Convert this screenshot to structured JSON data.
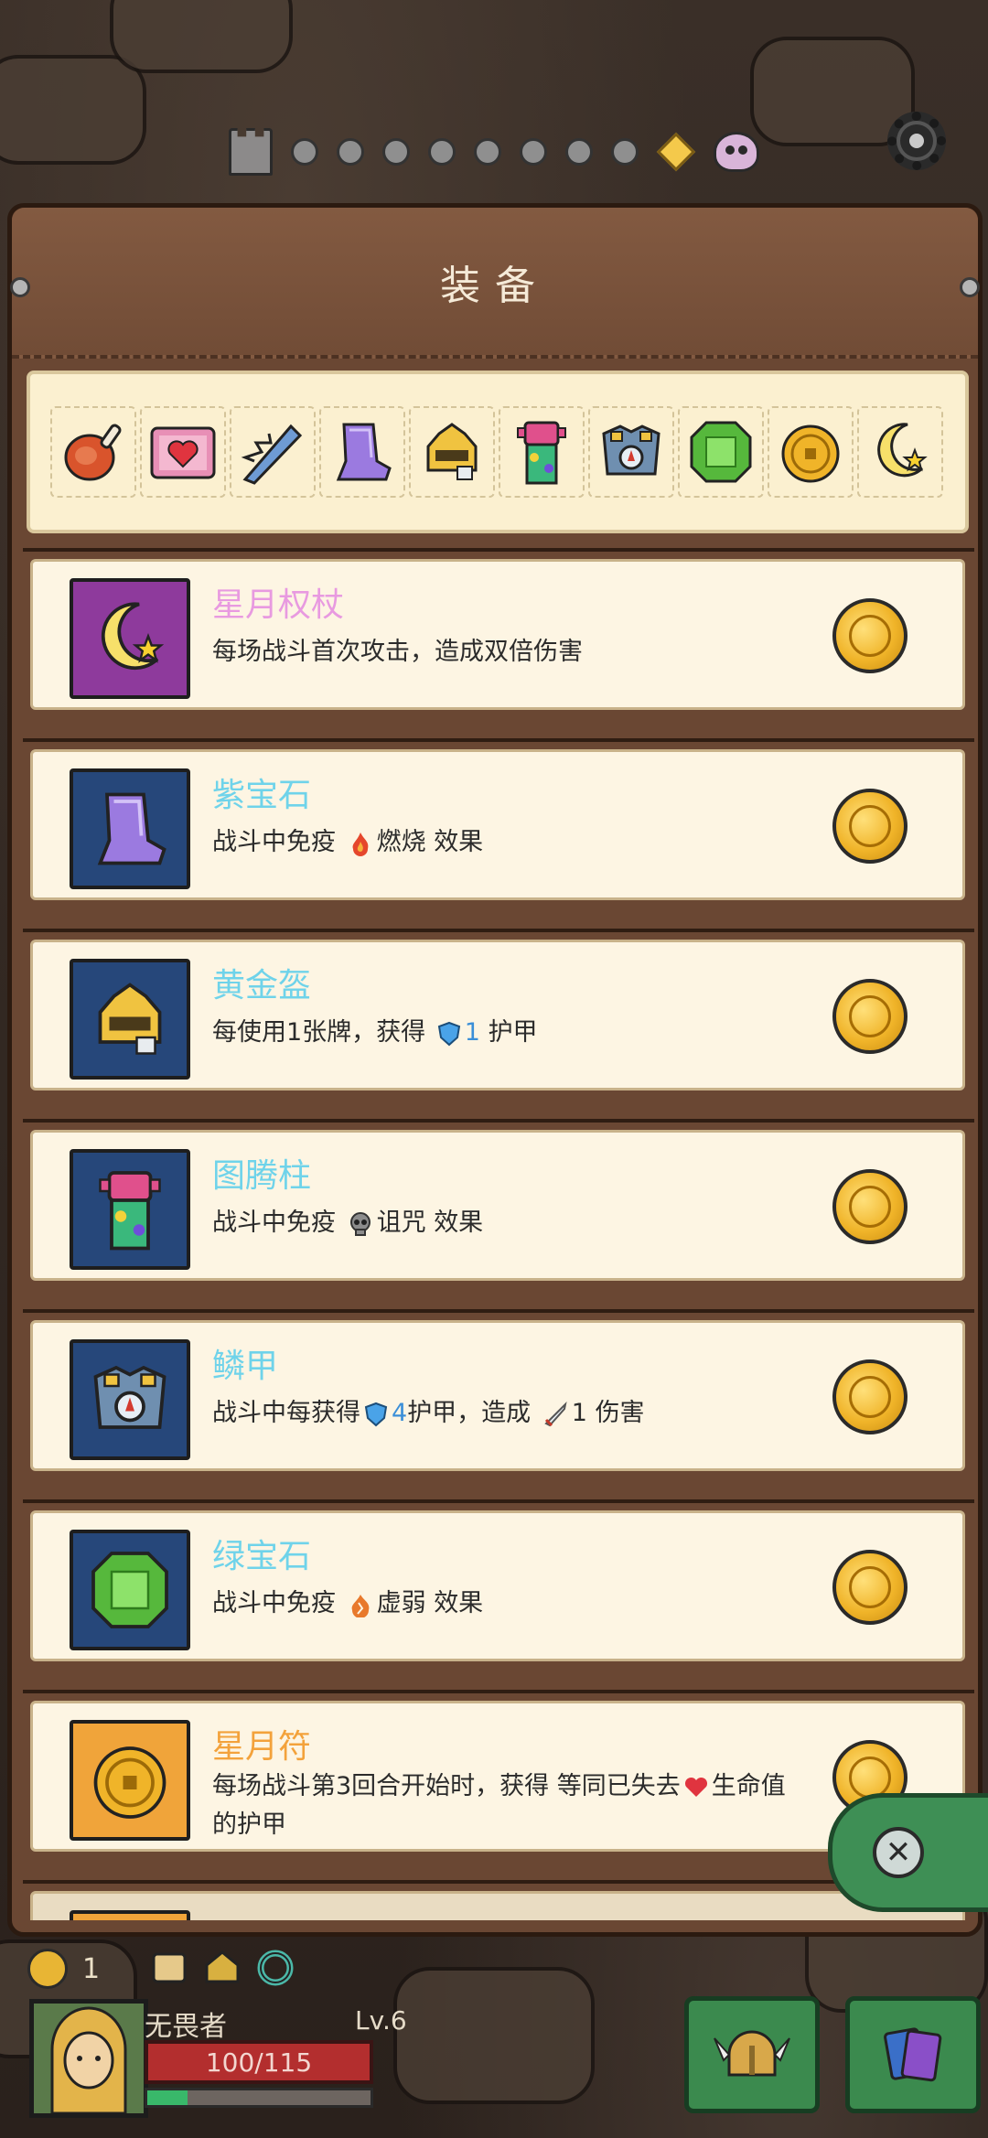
{
  "panel": {
    "title": "装备"
  },
  "equipment_strip": {
    "slots": [
      "meat-icon",
      "heart-box-icon",
      "spiked-club-icon",
      "purple-gem-boot-icon",
      "golden-helmet-icon",
      "totem-icon",
      "scale-armor-icon",
      "green-gem-icon",
      "gold-amulet-icon",
      "star-moon-scepter-icon"
    ]
  },
  "items": [
    {
      "name": "星月权杖",
      "name_color": "#e89ae0",
      "icon": "star-moon-scepter-icon",
      "icon_bg": "#8e3a9c",
      "desc_parts": [
        "每场战斗首次攻击，造成双倍伤害"
      ]
    },
    {
      "name": "紫宝石",
      "name_color": "#6fd3ea",
      "icon": "purple-gem-boot-icon",
      "icon_bg": "#26477a",
      "desc_parts": [
        "战斗中免疫",
        "燃烧",
        "效果"
      ],
      "status_icon": "fire-icon"
    },
    {
      "name": "黄金盔",
      "name_color": "#6fd3ea",
      "icon": "golden-helmet-icon",
      "icon_bg": "#26477a",
      "desc_parts": [
        "每使用1张牌，获得",
        "1",
        "护甲"
      ],
      "status_icon": "shield-icon"
    },
    {
      "name": "图腾柱",
      "name_color": "#6fd3ea",
      "icon": "totem-icon",
      "icon_bg": "#26477a",
      "desc_parts": [
        "战斗中免疫",
        "诅咒",
        "效果"
      ],
      "status_icon": "skull-icon"
    },
    {
      "name": "鳞甲",
      "name_color": "#6fd3ea",
      "icon": "scale-armor-icon",
      "icon_bg": "#26477a",
      "desc_parts": [
        "战斗中每获得",
        "4",
        "护甲，造成",
        "1",
        "伤害"
      ],
      "status_icon": "shield-icon",
      "status_icon2": "sword-icon"
    },
    {
      "name": "绿宝石",
      "name_color": "#6fd3ea",
      "icon": "green-gem-icon",
      "icon_bg": "#26477a",
      "desc_parts": [
        "战斗中免疫",
        "虚弱",
        "效果"
      ],
      "status_icon": "weak-icon"
    },
    {
      "name": "星月符",
      "name_color": "#f3a23b",
      "icon": "gold-amulet-icon",
      "icon_bg": "#f0a43a",
      "desc_parts": [
        "每场战斗第3回合开始时，获得 等同已失去",
        "生命值",
        "的护甲"
      ],
      "status_icon": "heart-icon"
    }
  ],
  "hud": {
    "gold": "1",
    "hero_name": "无畏者",
    "level": "Lv.6",
    "hp": "100/115",
    "xp_fraction": 0.18
  }
}
